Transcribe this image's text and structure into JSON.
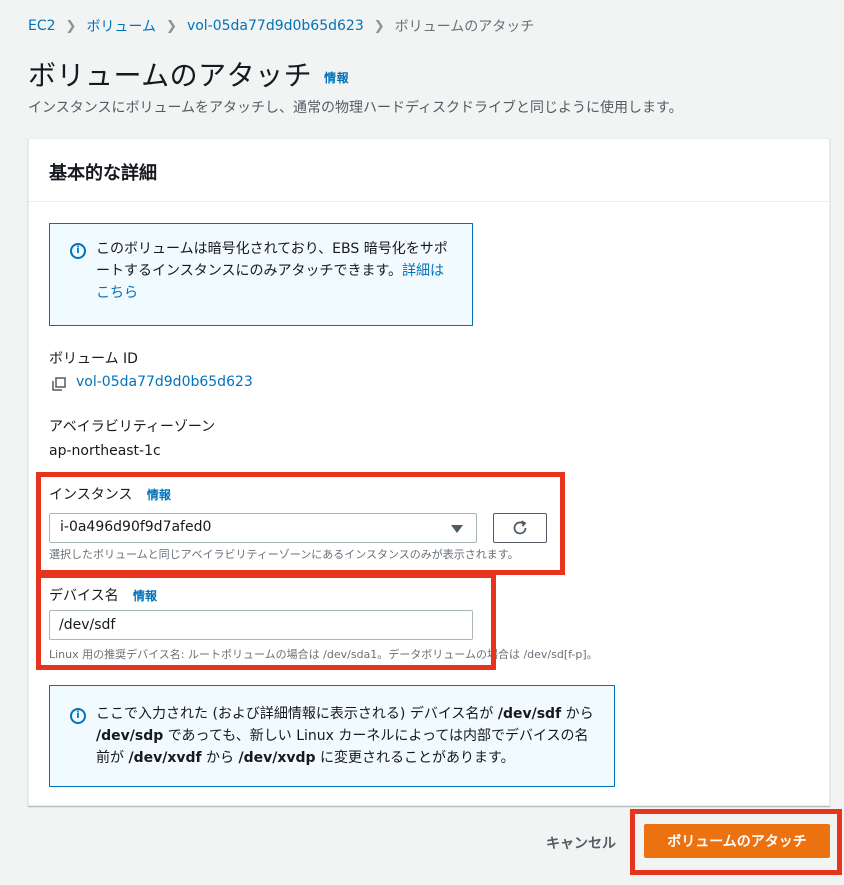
{
  "breadcrumb": {
    "items": [
      "EC2",
      "ボリューム",
      "vol-05da77d9d0b65d623"
    ],
    "current": "ボリュームのアタッチ"
  },
  "header": {
    "title": "ボリュームのアタッチ",
    "info": "情報",
    "description": "インスタンスにボリュームをアタッチし、通常の物理ハードディスクドライブと同じように使用します。"
  },
  "panel": {
    "title": "基本的な詳細",
    "encryption_alert": {
      "text": "このボリュームは暗号化されており、EBS 暗号化をサポートするインスタンスにのみアタッチできます。",
      "link": "詳細はこちら"
    },
    "volume_id": {
      "label": "ボリューム ID",
      "value": "vol-05da77d9d0b65d623"
    },
    "az": {
      "label": "アベイラビリティーゾーン",
      "value": "ap-northeast-1c"
    },
    "instance": {
      "label": "インスタンス",
      "info": "情報",
      "selected": "i-0a496d90f9d7afed0",
      "hint": "選択したボリュームと同じアベイラビリティーゾーンにあるインスタンスのみが表示されます。"
    },
    "device": {
      "label": "デバイス名",
      "info": "情報",
      "value": "/dev/sdf",
      "hint": "Linux 用の推奨デバイス名: ルートボリュームの場合は /dev/sda1。データボリュームの場合は /dev/sd[f-p]。"
    },
    "device_alert": {
      "t1": "ここで入力された (および詳細情報に表示される) デバイス名が ",
      "b1": "/dev/sdf",
      "t2": " から ",
      "b2": "/dev/sdp",
      "t3": " であっても、新しい Linux カーネルによっては内部でデバイスの名前が ",
      "b3": "/dev/xvdf",
      "t4": " から ",
      "b4": "/dev/xvdp",
      "t5": " に変更されることがあります。"
    }
  },
  "footer": {
    "cancel": "キャンセル",
    "attach": "ボリュームのアタッチ"
  },
  "icons": {
    "breadcrumb_separator": "chevron-right-icon",
    "alert": "info-icon",
    "copy": "copy-icon",
    "select": "caret-down-icon",
    "refresh": "refresh-icon"
  },
  "colors": {
    "link": "#0073bb",
    "primary_button": "#ec7211",
    "highlight": "#e8331f",
    "alert_bg": "#f1faff"
  }
}
